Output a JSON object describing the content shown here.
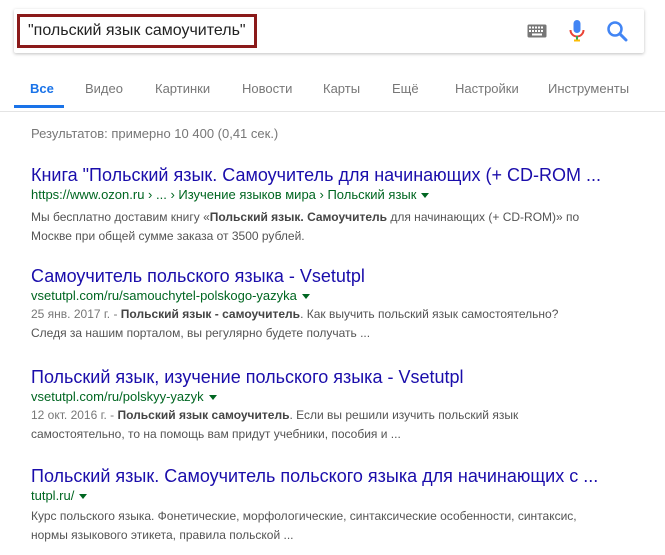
{
  "search": {
    "query": "\"польский язык самоучитель\""
  },
  "icons": {
    "keyboard": "keyboard-icon",
    "mic": "microphone-icon",
    "search": "search-icon"
  },
  "tabs": [
    {
      "label": "Все",
      "active": true
    },
    {
      "label": "Видео"
    },
    {
      "label": "Картинки"
    },
    {
      "label": "Новости"
    },
    {
      "label": "Карты"
    },
    {
      "label": "Ещё"
    },
    {
      "label": "Настройки"
    },
    {
      "label": "Инструменты"
    }
  ],
  "stats": "Результатов: примерно 10 400 (0,41 сек.)",
  "results": [
    {
      "title": "Книга \"Польский язык. Самоучитель для начинающих (+ CD-ROM ...",
      "url": "https://www.ozon.ru › ... › Изучение языков мира › Польский язык",
      "snip1_a": "Мы бесплатно доставим книгу «",
      "snip1_b": "Польский язык. Самоучитель",
      "snip1_c": " для начинающих (+ CD-ROM)» по",
      "snip2": "Москве при общей сумме заказа от 3500 рублей."
    },
    {
      "title": "Самоучитель польского языка - Vsetutpl",
      "url": "vsetutpl.com/ru/samouchytel-polskogo-yazyka",
      "date": "25 янв. 2017 г. - ",
      "snip1_b": "Польский язык - самоучитель",
      "snip1_c": ". Как выучить польский язык самостоятельно?",
      "snip2": "Следя за нашим порталом, вы регулярно будете получать ..."
    },
    {
      "title": "Польский язык, изучение польского языка - Vsetutpl",
      "url": "vsetutpl.com/ru/polskyy-yazyk",
      "date": "12 окт. 2016 г. - ",
      "snip1_b": "Польский язык самоучитель",
      "snip1_c": ". Если вы решили изучить польский язык",
      "snip2": "самостоятельно, то на помощь вам придут учебники, пособия и ..."
    },
    {
      "title": "Польский язык. Самоучитель польского языка для начинающих с ...",
      "url": "tutpl.ru/",
      "snip1": "Курс польского языка. Фонетические, морфологические, синтаксические особенности, синтаксис,",
      "snip2": "нормы языкового этикета, правила польской ..."
    }
  ]
}
